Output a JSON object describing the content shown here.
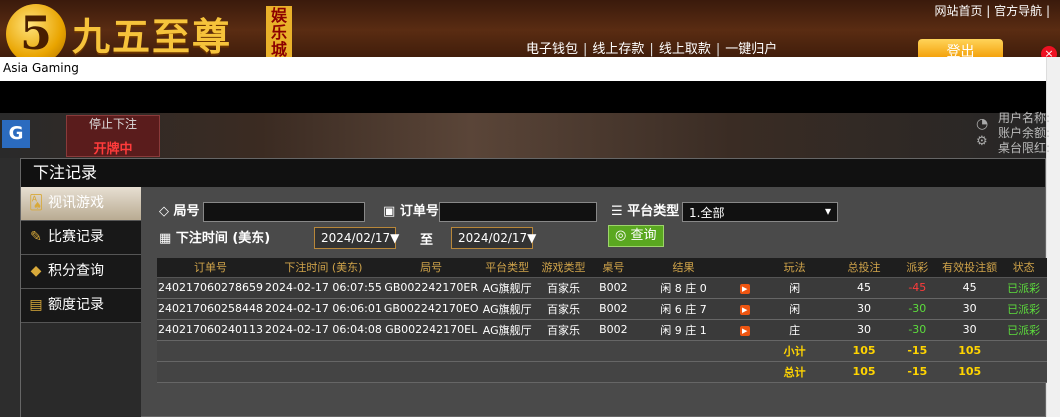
{
  "header": {
    "logo_digit": "5",
    "site_name": "九五至尊",
    "badge": "娱乐城",
    "top_links": "网站首页 | 官方导航 |",
    "links": [
      "电子钱包",
      "线上存款",
      "线上取款",
      "一键归户"
    ],
    "login_label": "登出",
    "close_label": "×"
  },
  "window_title": "Asia Gaming",
  "game": {
    "logo": "G",
    "stop_label": "停止下注",
    "status_label": "开牌中",
    "user_lines": [
      "用户名称:",
      "账户余额:",
      "桌台限红:"
    ]
  },
  "modal": {
    "title": "下注记录",
    "menu": [
      {
        "label": "视讯游戏",
        "icon": "cards-icon",
        "active": true
      },
      {
        "label": "比赛记录",
        "icon": "ticket-icon",
        "active": false
      },
      {
        "label": "积分查询",
        "icon": "diamond-icon",
        "active": false
      },
      {
        "label": "额度记录",
        "icon": "document-icon",
        "active": false
      }
    ],
    "filters": {
      "round_label": "局号",
      "round_value": "",
      "order_label": "订单号",
      "order_value": "",
      "platform_label": "平台类型",
      "platform_value": "1.全部",
      "time_label": "下注时间 (美东)",
      "date_from": "2024/02/17",
      "to_label": "至",
      "date_to": "2024/02/17",
      "query_label": "查询"
    },
    "table": {
      "headers": [
        "订单号",
        "下注时间 (美东)",
        "局号",
        "平台类型",
        "游戏类型",
        "桌号",
        "结果",
        "",
        "玩法",
        "总投注",
        "派彩",
        "有效投注额",
        "状态"
      ],
      "rows": [
        [
          "240217060278659",
          "2024-02-17 06:07:55",
          "GB002242170ER",
          "AG旗舰厅",
          "百家乐",
          "B002",
          "闲 8 庄 0",
          "闲",
          "45",
          "-45",
          "45",
          "已派彩"
        ],
        [
          "240217060258448",
          "2024-02-17 06:06:01",
          "GB002242170EO",
          "AG旗舰厅",
          "百家乐",
          "B002",
          "闲 6 庄 7",
          "闲",
          "30",
          "-30",
          "30",
          "已派彩"
        ],
        [
          "240217060240113",
          "2024-02-17 06:04:08",
          "GB002242170EL",
          "AG旗舰厅",
          "百家乐",
          "B002",
          "闲 9 庄 1",
          "庄",
          "30",
          "-30",
          "30",
          "已派彩"
        ]
      ],
      "subtotal": {
        "label": "小计",
        "total_bet": "105",
        "payout": "-15",
        "valid_bet": "105"
      },
      "total": {
        "label": "总计",
        "total_bet": "105",
        "payout": "-15",
        "valid_bet": "105"
      }
    }
  }
}
